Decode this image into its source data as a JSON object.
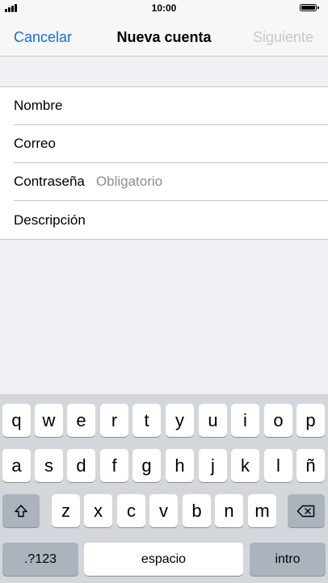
{
  "status_bar": {
    "time": "10:00"
  },
  "nav": {
    "cancel_label": "Cancelar",
    "title": "Nueva cuenta",
    "next_label": "Siguiente"
  },
  "form": {
    "fields": [
      {
        "label": "Nombre",
        "placeholder": ""
      },
      {
        "label": "Correo",
        "placeholder": ""
      },
      {
        "label": "Contraseña",
        "placeholder": "Obligatorio"
      },
      {
        "label": "Descripción",
        "placeholder": ""
      }
    ]
  },
  "keyboard": {
    "row1": [
      "q",
      "w",
      "e",
      "r",
      "t",
      "y",
      "u",
      "i",
      "o",
      "p"
    ],
    "row2": [
      "a",
      "s",
      "d",
      "f",
      "g",
      "h",
      "j",
      "k",
      "l",
      "ñ"
    ],
    "row3": [
      "z",
      "x",
      "c",
      "v",
      "b",
      "n",
      "m"
    ],
    "numbers_label": ".?123",
    "space_label": "espacio",
    "return_label": "intro"
  },
  "colors": {
    "accent": "#1570d6",
    "disabled": "#c7c7cc",
    "background": "#efeff4",
    "keyboard_background": "#d3d6db"
  },
  "icons": {
    "signal": "signal-icon",
    "battery": "battery-icon",
    "shift": "shift-icon",
    "delete": "delete-icon"
  }
}
